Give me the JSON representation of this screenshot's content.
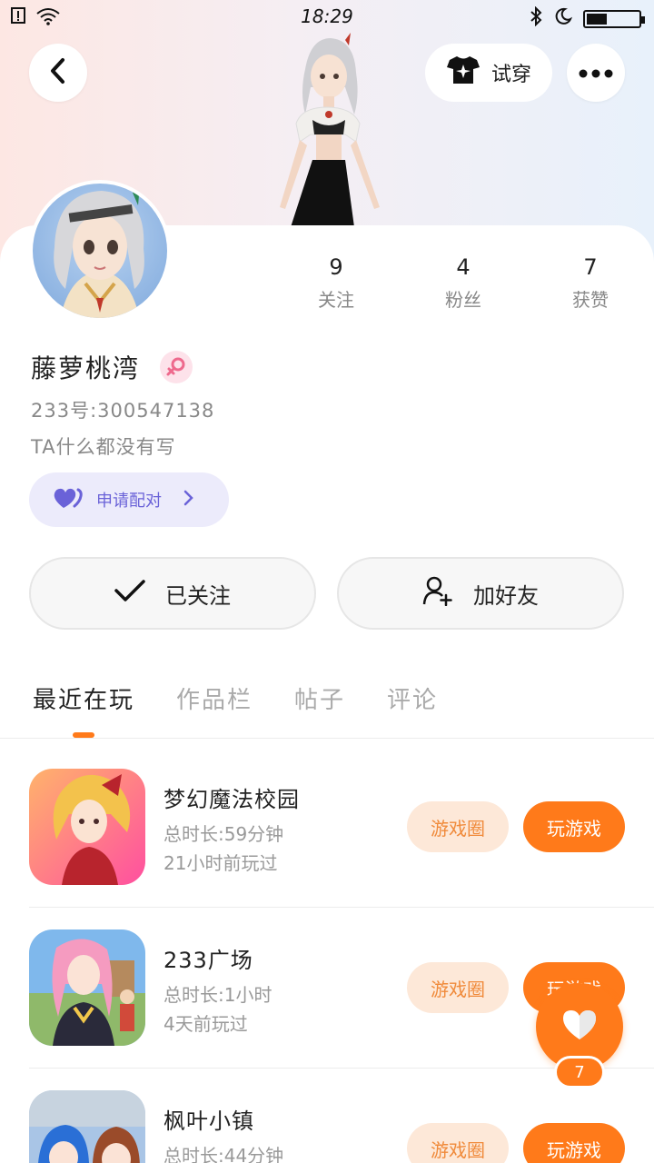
{
  "status_bar": {
    "time": "18:29",
    "battery_level": 0.4
  },
  "header": {
    "dressup_label": "试穿"
  },
  "profile": {
    "name": "藤萝桃湾",
    "uid": "233号:300547138",
    "bio": "TA什么都没有写",
    "pair_label": "申请配对",
    "stats": [
      {
        "num": "9",
        "label": "关注"
      },
      {
        "num": "4",
        "label": "粉丝"
      },
      {
        "num": "7",
        "label": "获赞"
      }
    ]
  },
  "actions": {
    "follow_label": "已关注",
    "add_friend_label": "加好友"
  },
  "tabs": [
    "最近在玩",
    "作品栏",
    "帖子",
    "评论"
  ],
  "games": [
    {
      "title": "梦幻魔法校园",
      "duration": "总时长:59分钟",
      "last_played": "21小时前玩过",
      "circle_label": "游戏圈",
      "play_label": "玩游戏"
    },
    {
      "title": "233广场",
      "duration": "总时长:1小时",
      "last_played": "4天前玩过",
      "circle_label": "游戏圈",
      "play_label": "玩游戏"
    },
    {
      "title": "枫叶小镇",
      "duration": "总时长:44分钟",
      "last_played": "",
      "circle_label": "游戏圈",
      "play_label": "玩游戏"
    }
  ],
  "like_fab": {
    "count": "7"
  },
  "colors": {
    "accent": "#ff7a1a",
    "pair_purple": "#6a62d8"
  }
}
